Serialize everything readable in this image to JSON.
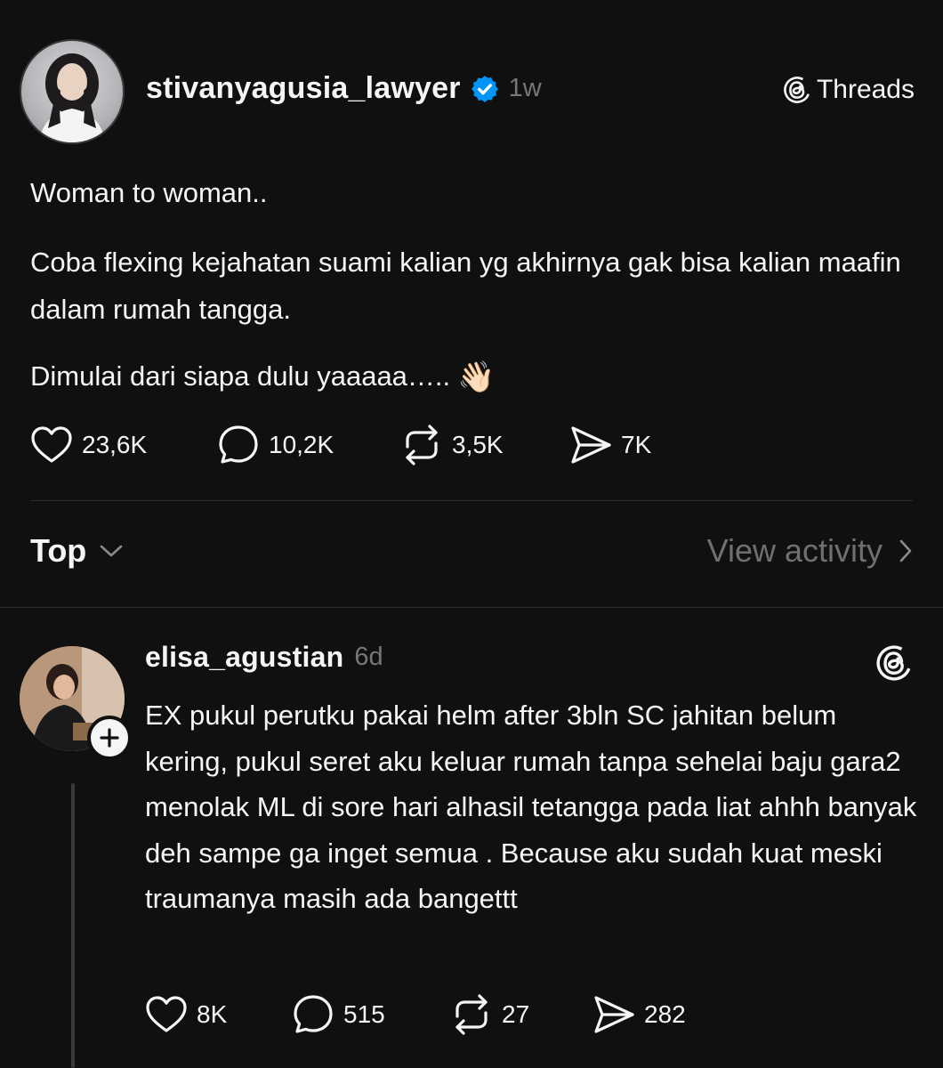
{
  "post": {
    "username": "stivanyagusia_lawyer",
    "time": "1w",
    "brand": "Threads",
    "paragraphs": [
      "Woman to woman..",
      "Coba flexing kejahatan suami kalian yg akhirnya gak bisa kalian maafin dalam rumah tangga.",
      "Dimulai dari siapa dulu yaaaaa….."
    ],
    "emoji": "👋🏻",
    "stats": {
      "likes": "23,6K",
      "replies": "10,2K",
      "reposts": "3,5K",
      "shares": "7K"
    }
  },
  "sort": {
    "label": "Top",
    "view_activity": "View activity"
  },
  "reply": {
    "username": "elisa_agustian",
    "time": "6d",
    "text": "EX pukul perutku pakai helm after 3bln SC jahitan belum kering, pukul seret aku keluar rumah tanpa sehelai baju gara2 menolak ML di sore hari alhasil tetangga pada liat ahhh banyak deh sampe ga inget semua . Because aku sudah kuat meski traumanya masih ada bangettt",
    "stats": {
      "likes": "8K",
      "replies": "515",
      "reposts": "27",
      "shares": "282"
    }
  },
  "colors": {
    "background": "#101010",
    "text": "#f3f5f7",
    "muted": "#777777",
    "verified": "#0095f6"
  }
}
